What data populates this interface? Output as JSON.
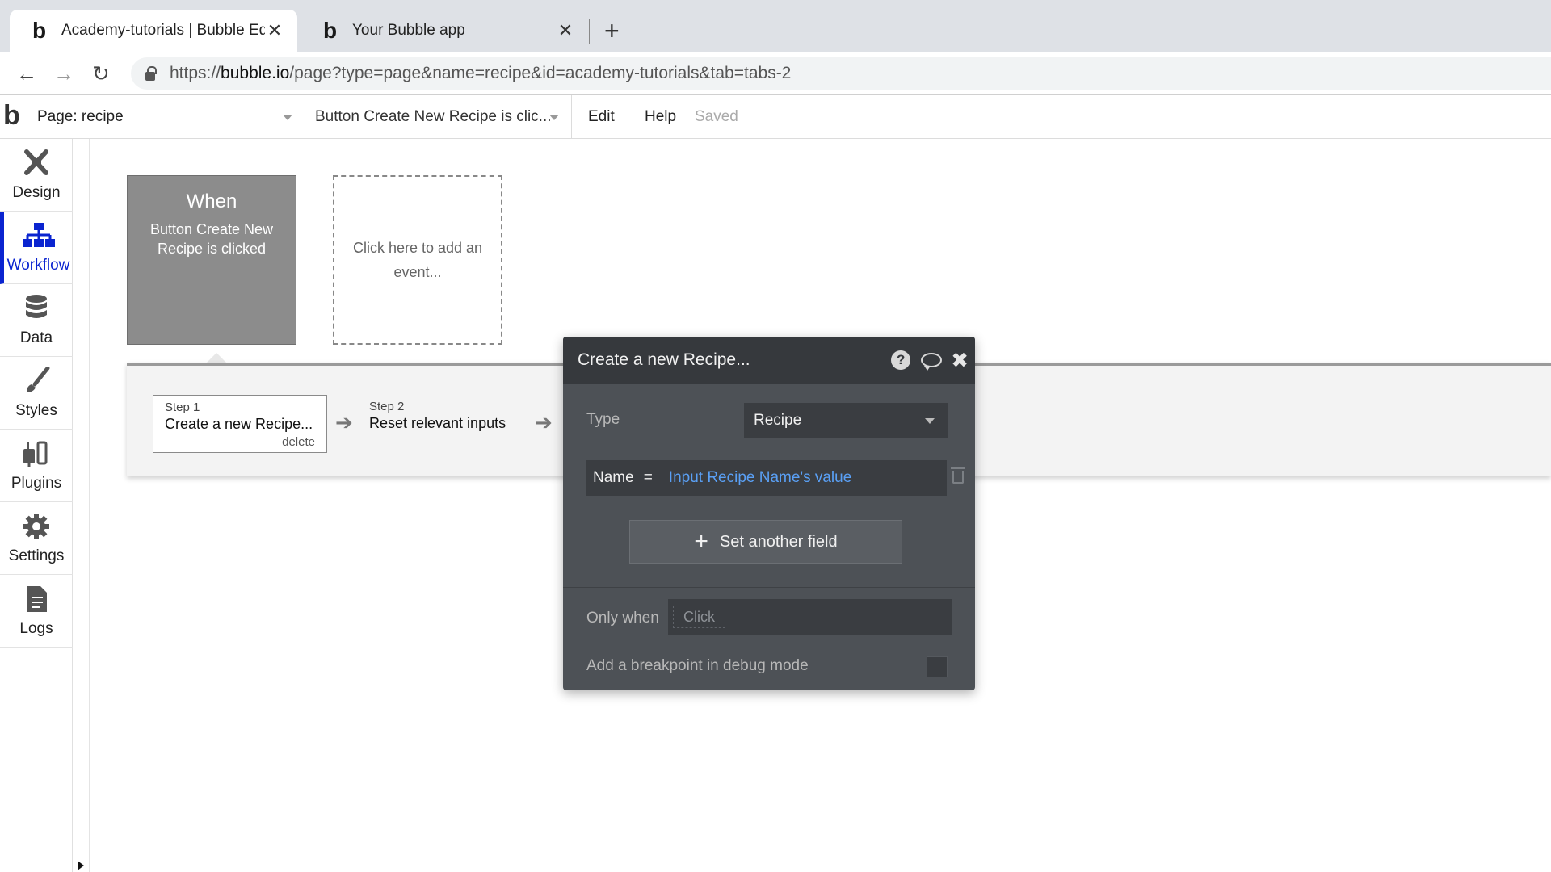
{
  "browser": {
    "tabs": [
      {
        "title": "Academy-tutorials | Bubble Editor",
        "active": true
      },
      {
        "title": "Your Bubble app",
        "active": false
      }
    ],
    "url_prefix": "https://",
    "url_host": "bubble.io",
    "url_path": "/page?type=page&name=recipe&id=academy-tutorials&tab=tabs-2"
  },
  "appbar": {
    "logo": ".b",
    "page_select": "Page: recipe",
    "event_select": "Button Create New Recipe is clic...",
    "menu": [
      "Edit",
      "Help"
    ],
    "status": "Saved"
  },
  "sidebar": {
    "items": [
      {
        "label": "Design",
        "icon": "design-icon",
        "active": false
      },
      {
        "label": "Workflow",
        "icon": "workflow-icon",
        "active": true
      },
      {
        "label": "Data",
        "icon": "database-icon",
        "active": false
      },
      {
        "label": "Styles",
        "icon": "brush-icon",
        "active": false
      },
      {
        "label": "Plugins",
        "icon": "plug-icon",
        "active": false
      },
      {
        "label": "Settings",
        "icon": "gear-icon",
        "active": false
      },
      {
        "label": "Logs",
        "icon": "document-icon",
        "active": false
      }
    ],
    "accent": "#0a24d0"
  },
  "workflow": {
    "event": {
      "when": "When",
      "description": "Button Create New Recipe is clicked"
    },
    "add_event": "Click here to add an event...",
    "steps": [
      {
        "number": "Step 1",
        "name": "Create a new Recipe...",
        "delete": "delete"
      },
      {
        "number": "Step 2",
        "name": "Reset relevant inputs"
      }
    ]
  },
  "dialog": {
    "title": "Create a new Recipe...",
    "type_label": "Type",
    "type_value": "Recipe",
    "field_name": "Name",
    "field_eq": "=",
    "field_value": "Input Recipe Name's value",
    "set_another": "Set another field",
    "only_when_label": "Only when",
    "only_when_placeholder": "Click",
    "breakpoint_label": "Add a breakpoint in debug mode",
    "link_color": "#5aa0f5"
  }
}
